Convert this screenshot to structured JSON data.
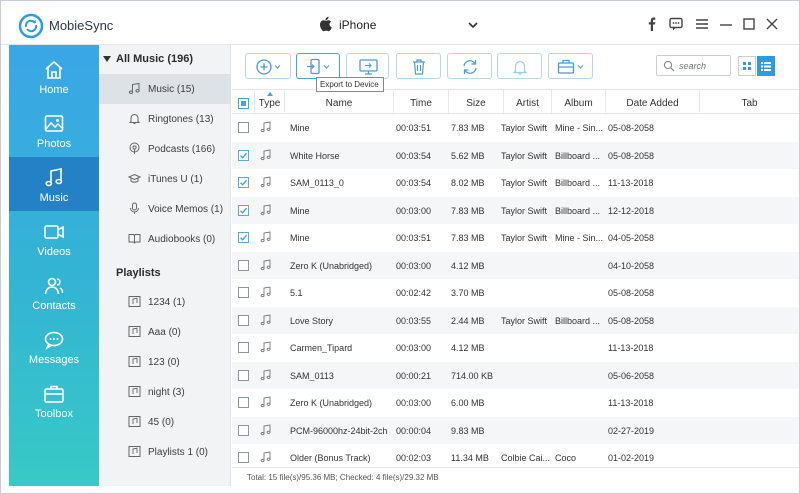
{
  "app": {
    "name": "MobieSync"
  },
  "device": {
    "name": "iPhone"
  },
  "sidebar": {
    "items": [
      {
        "label": "Home",
        "icon": "home-icon",
        "active": false
      },
      {
        "label": "Photos",
        "icon": "photos-icon",
        "active": false
      },
      {
        "label": "Music",
        "icon": "music-icon",
        "active": true
      },
      {
        "label": "Videos",
        "icon": "videos-icon",
        "active": false
      },
      {
        "label": "Contacts",
        "icon": "contacts-icon",
        "active": false
      },
      {
        "label": "Messages",
        "icon": "messages-icon",
        "active": false
      },
      {
        "label": "Toolbox",
        "icon": "toolbox-icon",
        "active": false
      }
    ]
  },
  "categories": {
    "header": "All Music (196)",
    "items": [
      {
        "label": "Music (15)",
        "icon": "music-note-icon",
        "active": true
      },
      {
        "label": "Ringtones (13)",
        "icon": "bell-icon",
        "active": false
      },
      {
        "label": "Podcasts (166)",
        "icon": "podcast-icon",
        "active": false
      },
      {
        "label": "iTunes U (1)",
        "icon": "graduation-cap-icon",
        "active": false
      },
      {
        "label": "Voice Memos (1)",
        "icon": "microphone-icon",
        "active": false
      },
      {
        "label": "Audiobooks (0)",
        "icon": "book-icon",
        "active": false
      }
    ],
    "playlists_header": "Playlists",
    "playlists": [
      {
        "label": "1234 (1)"
      },
      {
        "label": "Aaa (0)"
      },
      {
        "label": "123 (0)"
      },
      {
        "label": "night (3)"
      },
      {
        "label": "45 (0)"
      },
      {
        "label": "Playlists 1 (0)"
      }
    ]
  },
  "toolbar": {
    "tooltip": "Export to Device",
    "search_placeholder": "search"
  },
  "table": {
    "columns": [
      "Type",
      "Name",
      "Time",
      "Size",
      "Artist",
      "Album",
      "Date Added",
      "Tab"
    ],
    "rows": [
      {
        "checked": false,
        "name": "Mine",
        "time": "00:03:51",
        "size": "7.83 MB",
        "artist": "Taylor Swift",
        "album": "Mine - Sin...",
        "date": "05-08-2058"
      },
      {
        "checked": true,
        "name": "White Horse",
        "time": "00:03:54",
        "size": "5.62 MB",
        "artist": "Taylor Swift",
        "album": "Billboard ...",
        "date": "05-08-2058"
      },
      {
        "checked": true,
        "name": "SAM_0113_0",
        "time": "00:03:54",
        "size": "8.02 MB",
        "artist": "Taylor Swift",
        "album": "Billboard ...",
        "date": "11-13-2018"
      },
      {
        "checked": true,
        "name": "Mine",
        "time": "00:03:00",
        "size": "7.83 MB",
        "artist": "Taylor Swift",
        "album": "Billboard ...",
        "date": "12-12-2018"
      },
      {
        "checked": true,
        "name": "Mine",
        "time": "00:03:51",
        "size": "7.83 MB",
        "artist": "Taylor Swift",
        "album": "Mine - Sin...",
        "date": "04-05-2058"
      },
      {
        "checked": false,
        "name": "Zero K (Unabridged)",
        "time": "00:03:00",
        "size": "4.12 MB",
        "artist": "",
        "album": "",
        "date": "04-10-2058"
      },
      {
        "checked": false,
        "name": "5.1",
        "time": "00:02:42",
        "size": "3.70 MB",
        "artist": "",
        "album": "",
        "date": "05-08-2058"
      },
      {
        "checked": false,
        "name": "Love Story",
        "time": "00:03:55",
        "size": "2.44 MB",
        "artist": "Taylor Swift",
        "album": "Billboard ...",
        "date": "05-08-2058"
      },
      {
        "checked": false,
        "name": "Carmen_Tipard",
        "time": "00:03:00",
        "size": "4.12 MB",
        "artist": "",
        "album": "",
        "date": "11-13-2018"
      },
      {
        "checked": false,
        "name": "SAM_0113",
        "time": "00:00:21",
        "size": "714.00 KB",
        "artist": "",
        "album": "",
        "date": "05-06-2058"
      },
      {
        "checked": false,
        "name": "Zero K (Unabridged)",
        "time": "00:03:00",
        "size": "6.00 MB",
        "artist": "",
        "album": "",
        "date": "11-13-2018"
      },
      {
        "checked": false,
        "name": "PCM-96000hz-24bit-2ch",
        "time": "00:00:04",
        "size": "9.83 MB",
        "artist": "",
        "album": "",
        "date": "02-27-2019"
      },
      {
        "checked": false,
        "name": "Older (Bonus Track)",
        "time": "00:02:03",
        "size": "11.34 MB",
        "artist": "Colbie Cai...",
        "album": "Coco",
        "date": "01-02-2019"
      }
    ]
  },
  "status": {
    "text": "Total: 15 file(s)/95.36 MB; Checked: 4 file(s)/29.32 MB"
  },
  "colors": {
    "accent": "#2e9be0",
    "sidebar_active": "#2581c6",
    "sidebar_top": "#3aa6e6",
    "sidebar_bottom": "#38c9c6"
  }
}
